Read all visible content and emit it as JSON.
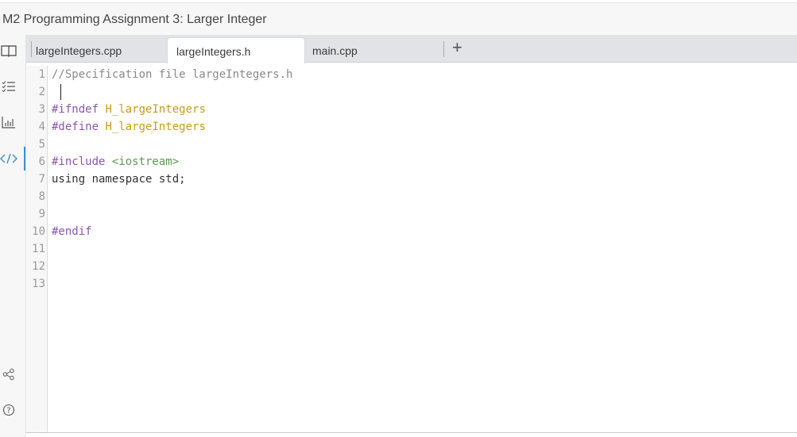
{
  "window": {
    "title": "M2 Programming Assignment 3: Larger Integer"
  },
  "sidebar": {
    "items": [
      {
        "name": "book-icon",
        "label": "Reading"
      },
      {
        "name": "checklist-icon",
        "label": "Checklist"
      },
      {
        "name": "chart-icon",
        "label": "Stats"
      },
      {
        "name": "code-icon",
        "label": "Code",
        "active": true
      },
      {
        "name": "share-icon",
        "label": "Share"
      },
      {
        "name": "help-icon",
        "label": "Help"
      }
    ],
    "active_color": "#3b8fd4"
  },
  "tabs": [
    {
      "label": "largeIntegers.cpp",
      "active": false
    },
    {
      "label": "largeIntegers.h",
      "active": true
    },
    {
      "label": "main.cpp",
      "active": false
    }
  ],
  "add_tab_label": "+",
  "editor": {
    "line_numbers": [
      "1",
      "2",
      "3",
      "4",
      "5",
      "6",
      "7",
      "8",
      "9",
      "10",
      "11",
      "12",
      "13"
    ],
    "lines": [
      [
        {
          "t": "//Specification file largeIntegers.h",
          "c": "comment"
        }
      ],
      [],
      [
        {
          "t": "#ifndef ",
          "c": "meta"
        },
        {
          "t": "H_largeIntegers",
          "c": "def"
        }
      ],
      [
        {
          "t": "#define ",
          "c": "meta"
        },
        {
          "t": "H_largeIntegers",
          "c": "def"
        }
      ],
      [],
      [
        {
          "t": "#include ",
          "c": "meta"
        },
        {
          "t": "<iostream>",
          "c": "string"
        }
      ],
      [
        {
          "t": "using namespace std;",
          "c": "plain"
        }
      ],
      [],
      [],
      [
        {
          "t": "#endif",
          "c": "meta"
        }
      ],
      [],
      [],
      []
    ],
    "cursor_line": 2
  },
  "colors": {
    "comment": "#8a8a8a",
    "meta": "#8a56b5",
    "def": "#c99a1a",
    "string": "#5c9a52",
    "plain": "#333333"
  }
}
